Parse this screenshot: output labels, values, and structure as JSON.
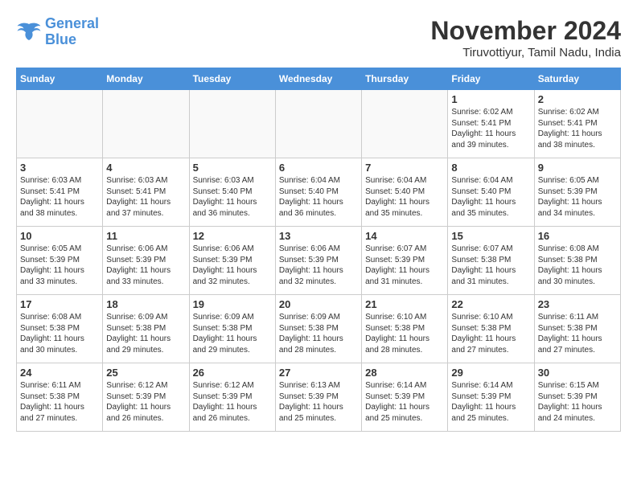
{
  "logo": {
    "line1": "General",
    "line2": "Blue"
  },
  "title": "November 2024",
  "subtitle": "Tiruvottiyur, Tamil Nadu, India",
  "weekdays": [
    "Sunday",
    "Monday",
    "Tuesday",
    "Wednesday",
    "Thursday",
    "Friday",
    "Saturday"
  ],
  "weeks": [
    [
      {
        "day": "",
        "info": ""
      },
      {
        "day": "",
        "info": ""
      },
      {
        "day": "",
        "info": ""
      },
      {
        "day": "",
        "info": ""
      },
      {
        "day": "",
        "info": ""
      },
      {
        "day": "1",
        "info": "Sunrise: 6:02 AM\nSunset: 5:41 PM\nDaylight: 11 hours\nand 39 minutes."
      },
      {
        "day": "2",
        "info": "Sunrise: 6:02 AM\nSunset: 5:41 PM\nDaylight: 11 hours\nand 38 minutes."
      }
    ],
    [
      {
        "day": "3",
        "info": "Sunrise: 6:03 AM\nSunset: 5:41 PM\nDaylight: 11 hours\nand 38 minutes."
      },
      {
        "day": "4",
        "info": "Sunrise: 6:03 AM\nSunset: 5:41 PM\nDaylight: 11 hours\nand 37 minutes."
      },
      {
        "day": "5",
        "info": "Sunrise: 6:03 AM\nSunset: 5:40 PM\nDaylight: 11 hours\nand 36 minutes."
      },
      {
        "day": "6",
        "info": "Sunrise: 6:04 AM\nSunset: 5:40 PM\nDaylight: 11 hours\nand 36 minutes."
      },
      {
        "day": "7",
        "info": "Sunrise: 6:04 AM\nSunset: 5:40 PM\nDaylight: 11 hours\nand 35 minutes."
      },
      {
        "day": "8",
        "info": "Sunrise: 6:04 AM\nSunset: 5:40 PM\nDaylight: 11 hours\nand 35 minutes."
      },
      {
        "day": "9",
        "info": "Sunrise: 6:05 AM\nSunset: 5:39 PM\nDaylight: 11 hours\nand 34 minutes."
      }
    ],
    [
      {
        "day": "10",
        "info": "Sunrise: 6:05 AM\nSunset: 5:39 PM\nDaylight: 11 hours\nand 33 minutes."
      },
      {
        "day": "11",
        "info": "Sunrise: 6:06 AM\nSunset: 5:39 PM\nDaylight: 11 hours\nand 33 minutes."
      },
      {
        "day": "12",
        "info": "Sunrise: 6:06 AM\nSunset: 5:39 PM\nDaylight: 11 hours\nand 32 minutes."
      },
      {
        "day": "13",
        "info": "Sunrise: 6:06 AM\nSunset: 5:39 PM\nDaylight: 11 hours\nand 32 minutes."
      },
      {
        "day": "14",
        "info": "Sunrise: 6:07 AM\nSunset: 5:39 PM\nDaylight: 11 hours\nand 31 minutes."
      },
      {
        "day": "15",
        "info": "Sunrise: 6:07 AM\nSunset: 5:38 PM\nDaylight: 11 hours\nand 31 minutes."
      },
      {
        "day": "16",
        "info": "Sunrise: 6:08 AM\nSunset: 5:38 PM\nDaylight: 11 hours\nand 30 minutes."
      }
    ],
    [
      {
        "day": "17",
        "info": "Sunrise: 6:08 AM\nSunset: 5:38 PM\nDaylight: 11 hours\nand 30 minutes."
      },
      {
        "day": "18",
        "info": "Sunrise: 6:09 AM\nSunset: 5:38 PM\nDaylight: 11 hours\nand 29 minutes."
      },
      {
        "day": "19",
        "info": "Sunrise: 6:09 AM\nSunset: 5:38 PM\nDaylight: 11 hours\nand 29 minutes."
      },
      {
        "day": "20",
        "info": "Sunrise: 6:09 AM\nSunset: 5:38 PM\nDaylight: 11 hours\nand 28 minutes."
      },
      {
        "day": "21",
        "info": "Sunrise: 6:10 AM\nSunset: 5:38 PM\nDaylight: 11 hours\nand 28 minutes."
      },
      {
        "day": "22",
        "info": "Sunrise: 6:10 AM\nSunset: 5:38 PM\nDaylight: 11 hours\nand 27 minutes."
      },
      {
        "day": "23",
        "info": "Sunrise: 6:11 AM\nSunset: 5:38 PM\nDaylight: 11 hours\nand 27 minutes."
      }
    ],
    [
      {
        "day": "24",
        "info": "Sunrise: 6:11 AM\nSunset: 5:38 PM\nDaylight: 11 hours\nand 27 minutes."
      },
      {
        "day": "25",
        "info": "Sunrise: 6:12 AM\nSunset: 5:39 PM\nDaylight: 11 hours\nand 26 minutes."
      },
      {
        "day": "26",
        "info": "Sunrise: 6:12 AM\nSunset: 5:39 PM\nDaylight: 11 hours\nand 26 minutes."
      },
      {
        "day": "27",
        "info": "Sunrise: 6:13 AM\nSunset: 5:39 PM\nDaylight: 11 hours\nand 25 minutes."
      },
      {
        "day": "28",
        "info": "Sunrise: 6:14 AM\nSunset: 5:39 PM\nDaylight: 11 hours\nand 25 minutes."
      },
      {
        "day": "29",
        "info": "Sunrise: 6:14 AM\nSunset: 5:39 PM\nDaylight: 11 hours\nand 25 minutes."
      },
      {
        "day": "30",
        "info": "Sunrise: 6:15 AM\nSunset: 5:39 PM\nDaylight: 11 hours\nand 24 minutes."
      }
    ]
  ]
}
